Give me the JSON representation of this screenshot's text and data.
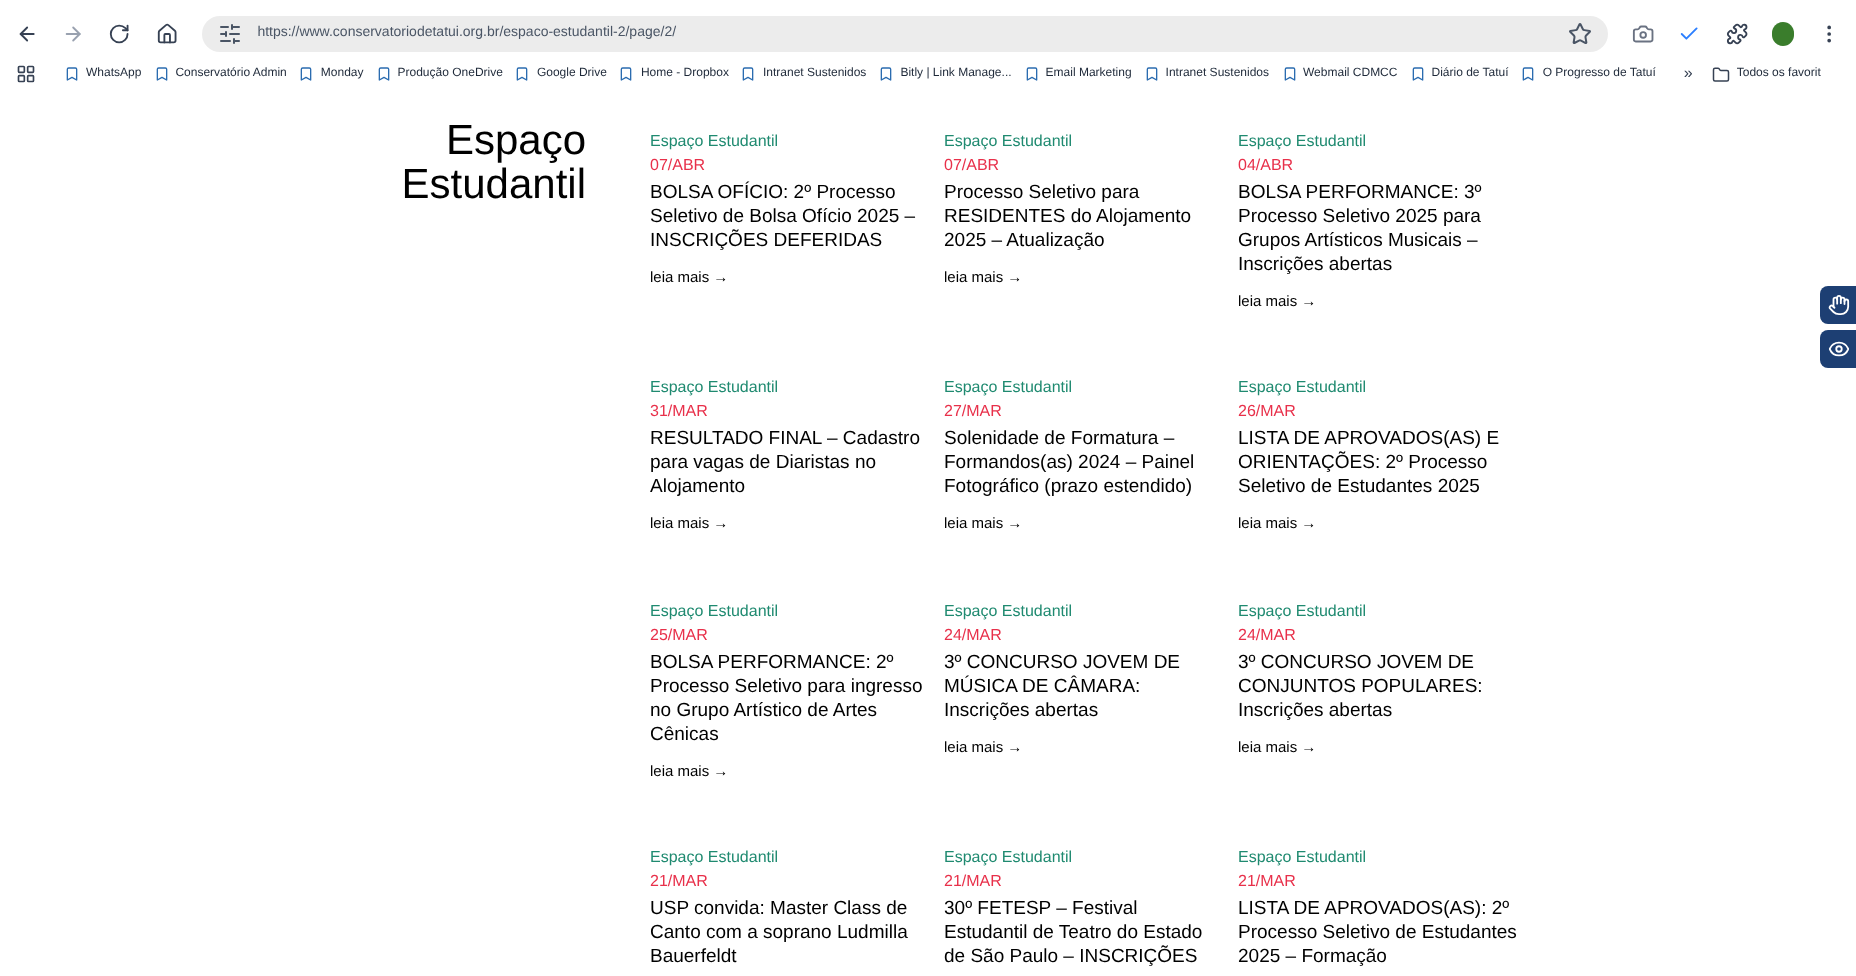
{
  "browser": {
    "url": "https://www.conservatoriodetatui.org.br/espaco-estudantil-2/page/2/",
    "bookmarks": [
      "WhatsApp",
      "Conservatório Admin",
      "Monday",
      "Produção OneDrive",
      "Google Drive",
      "Home - Dropbox",
      "Intranet Sustenidos",
      "Bitly | Link Manage...",
      "Email Marketing",
      "Intranet Sustenidos",
      "Webmail CDMCC",
      "Diário de Tatuí",
      "O Progresso de Tatuí"
    ],
    "more": "»",
    "all_bookmarks": "Todos os favorit"
  },
  "page": {
    "title": "Espaço Estudantil",
    "posts": [
      {
        "category": "Espaço Estudantil",
        "date": "07/ABR",
        "title": "BOLSA OFÍCIO: 2º Processo Seletivo de Bolsa Ofício 2025 – INSCRIÇÕES DEFERIDAS",
        "link": "leia mais →"
      },
      {
        "category": "Espaço Estudantil",
        "date": "07/ABR",
        "title": "Processo Seletivo para RESIDENTES do Alojamento 2025 – Atualização",
        "link": "leia mais →"
      },
      {
        "category": "Espaço Estudantil",
        "date": "04/ABR",
        "title": "BOLSA PERFORMANCE: 3º Processo Seletivo 2025 para Grupos Artísticos Musicais – Inscrições abertas",
        "link": "leia mais →"
      },
      {
        "category": "Espaço Estudantil",
        "date": "31/MAR",
        "title": "RESULTADO FINAL – Cadastro para vagas de Diaristas no Alojamento",
        "link": "leia mais →"
      },
      {
        "category": "Espaço Estudantil",
        "date": "27/MAR",
        "title": "Solenidade de Formatura – Formandos(as) 2024 – Painel Fotográfico (prazo estendido)",
        "link": "leia mais →"
      },
      {
        "category": "Espaço Estudantil",
        "date": "26/MAR",
        "title": "LISTA DE APROVADOS(AS) E ORIENTAÇÕES: 2º Processo Seletivo de Estudantes 2025",
        "link": "leia mais →"
      },
      {
        "category": "Espaço Estudantil",
        "date": "25/MAR",
        "title": "BOLSA PERFORMANCE: 2º Processo Seletivo para ingresso no Grupo Artístico de Artes Cênicas",
        "link": "leia mais →"
      },
      {
        "category": "Espaço Estudantil",
        "date": "24/MAR",
        "title": "3º CONCURSO JOVEM DE MÚSICA DE CÂMARA: Inscrições abertas",
        "link": "leia mais →"
      },
      {
        "category": "Espaço Estudantil",
        "date": "24/MAR",
        "title": "3º CONCURSO JOVEM DE CONJUNTOS POPULARES: Inscrições abertas",
        "link": "leia mais →"
      },
      {
        "category": "Espaço Estudantil",
        "date": "21/MAR",
        "title": "USP convida: Master Class de Canto com a soprano Ludmilla Bauerfeldt"
      },
      {
        "category": "Espaço Estudantil",
        "date": "21/MAR",
        "title": "30º FETESP – Festival Estudantil de Teatro do Estado de São Paulo – INSCRIÇÕES"
      },
      {
        "category": "Espaço Estudantil",
        "date": "21/MAR",
        "title": "LISTA DE APROVADOS(AS): 2º Processo Seletivo de Estudantes 2025 – Formação"
      }
    ]
  }
}
